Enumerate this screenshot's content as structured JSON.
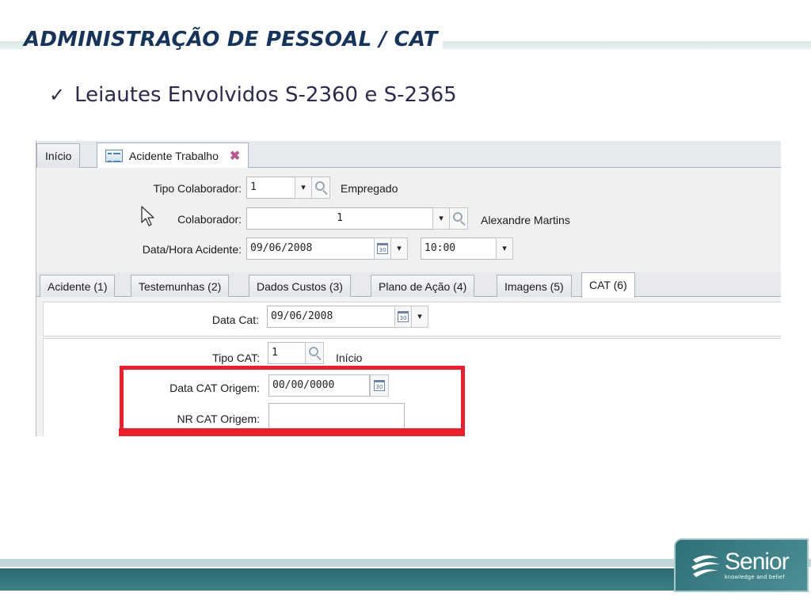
{
  "slide": {
    "title": "ADMINISTRAÇÃO DE PESSOAL / CAT",
    "bullet_check": "✓",
    "bullet": "Leiautes Envolvidos S-2360 e S-2365"
  },
  "app": {
    "main_tabs": [
      {
        "label": "Início"
      },
      {
        "label": "Acidente Trabalho",
        "active": true
      }
    ],
    "header": {
      "tipo_colaborador": {
        "label": "Tipo Colaborador:",
        "value": "1",
        "description": "Empregado"
      },
      "colaborador": {
        "label": "Colaborador:",
        "value": "1",
        "description": "Alexandre Martins"
      },
      "data_hora": {
        "label": "Data/Hora Acidente:",
        "date": "09/06/2008",
        "time": "10:00"
      }
    },
    "sub_tabs": [
      {
        "label": "Acidente (1)"
      },
      {
        "label": "Testemunhas (2)"
      },
      {
        "label": "Dados Custos (3)"
      },
      {
        "label": "Plano de Ação (4)"
      },
      {
        "label": "Imagens (5)"
      },
      {
        "label": "CAT (6)",
        "active": true
      }
    ],
    "cat": {
      "data_cat": {
        "label": "Data Cat:",
        "value": "09/06/2008"
      },
      "tipo_cat": {
        "label": "Tipo CAT:",
        "value": "1",
        "description": "Início"
      },
      "data_cat_origem": {
        "label": "Data CAT Origem:",
        "value": "00/00/0000"
      },
      "nr_cat_origem": {
        "label": "NR CAT Origem:",
        "value": ""
      }
    },
    "calendar_icon_text": "30",
    "spin_glyph": "▾",
    "close_glyph": "✖"
  },
  "logo": {
    "name": "Senior",
    "tagline": "knowledge and belief"
  },
  "colors": {
    "title": "#16335a",
    "highlight": "#e8202b",
    "brand": "#2f7078"
  }
}
